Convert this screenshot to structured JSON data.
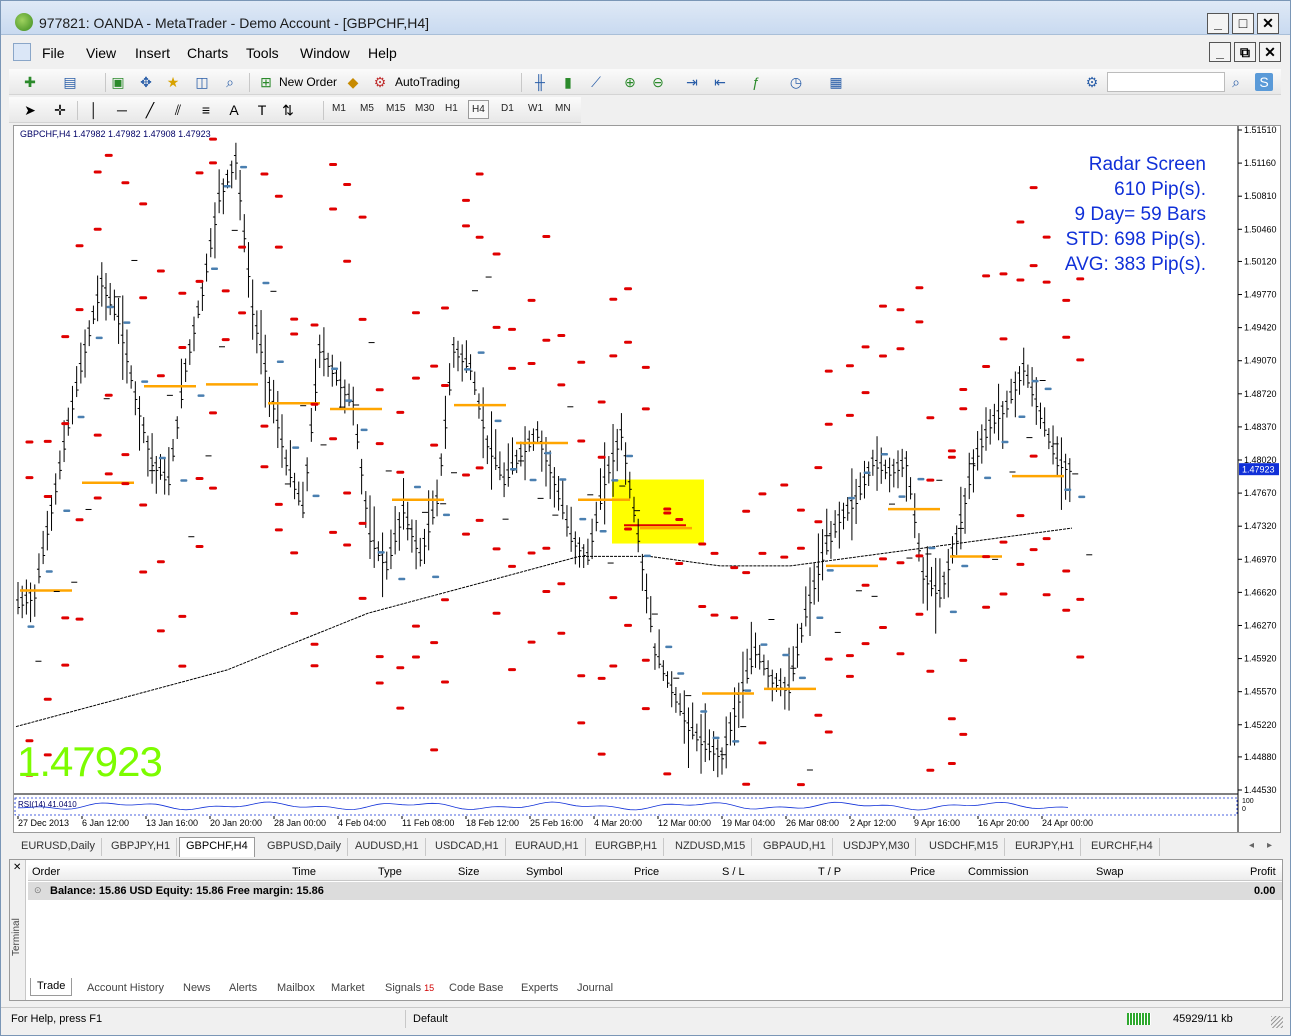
{
  "window": {
    "title": "977821: OANDA - MetaTrader - Demo Account - [GBPCHF,H4]",
    "minimize": "_",
    "maximize": "□",
    "close": "✕"
  },
  "menu": [
    "File",
    "View",
    "Insert",
    "Charts",
    "Tools",
    "Window",
    "Help"
  ],
  "toolbar": {
    "new_order": "New Order",
    "autotrading": "AutoTrading"
  },
  "timeframes": [
    "M1",
    "M5",
    "M15",
    "M30",
    "H1",
    "H4",
    "D1",
    "W1",
    "MN"
  ],
  "active_timeframe": "H4",
  "chart": {
    "header": "GBPCHF,H4  1.47982 1.47982 1.47908 1.47923",
    "big_price": "1.47923",
    "current_price_label": "1.47923",
    "radar": {
      "line1": "Radar Screen",
      "line2": "610 Pip(s).",
      "line3": "9 Day= 59 Bars",
      "line4": "STD: 698 Pip(s).",
      "line5": "AVG: 383 Pip(s)."
    },
    "rsi_label": "RSI(14) 41.0410",
    "rsi_scale_top": "100",
    "rsi_scale_bottom": "0",
    "colors": {
      "bars": "#000000",
      "red_marker": "#e00000",
      "blue_marker": "#4a7fb0",
      "orange_level": "#ffa500",
      "highlight_box": "#ffff00",
      "radar_text": "#1030d8",
      "big_price": "#7cfc00",
      "price_tag_bg": "#1030d8"
    }
  },
  "chart_data": {
    "type": "line",
    "title": "GBPCHF,H4",
    "x_ticks": [
      "27 Dec 2013",
      "6 Jan 12:00",
      "13 Jan 16:00",
      "20 Jan 20:00",
      "28 Jan 00:00",
      "4 Feb 04:00",
      "11 Feb 08:00",
      "18 Feb 12:00",
      "25 Feb 16:00",
      "4 Mar 20:00",
      "12 Mar 00:00",
      "19 Mar 04:00",
      "26 Mar 08:00",
      "2 Apr 12:00",
      "9 Apr 16:00",
      "16 Apr 20:00",
      "24 Apr 00:00"
    ],
    "y_ticks": [
      "1.51510",
      "1.51160",
      "1.50810",
      "1.50460",
      "1.50120",
      "1.49770",
      "1.49420",
      "1.49070",
      "1.48720",
      "1.48370",
      "1.48020",
      "1.47670",
      "1.47320",
      "1.46970",
      "1.46620",
      "1.46270",
      "1.45920",
      "1.45570",
      "1.45220",
      "1.44880",
      "1.44530"
    ],
    "ylim": [
      1.4453,
      1.5151
    ],
    "series": [
      {
        "name": "GBPCHF,H4",
        "values": [
          1.465,
          1.466,
          1.475,
          1.484,
          1.492,
          1.499,
          1.495,
          1.487,
          1.48,
          1.478,
          1.49,
          1.498,
          1.508,
          1.512,
          1.496,
          1.488,
          1.48,
          1.475,
          1.492,
          1.489,
          1.486,
          1.472,
          1.469,
          1.475,
          1.47,
          1.476,
          1.492,
          1.49,
          1.482,
          1.478,
          1.481,
          1.483,
          1.478,
          1.472,
          1.47,
          1.478,
          1.483,
          1.472,
          1.46,
          1.456,
          1.452,
          1.45,
          1.449,
          1.455,
          1.46,
          1.457,
          1.456,
          1.464,
          1.47,
          1.474,
          1.476,
          1.48,
          1.479,
          1.48,
          1.468,
          1.466,
          1.472,
          1.48,
          1.484,
          1.486,
          1.49,
          1.485,
          1.48,
          1.4792
        ]
      }
    ],
    "moving_average": [
      1.452,
      1.454,
      1.456,
      1.458,
      1.461,
      1.464,
      1.466,
      1.468,
      1.47,
      1.47,
      1.469,
      1.469,
      1.47,
      1.471,
      1.472,
      1.473
    ],
    "levels": [
      1.4664,
      1.4778,
      1.488,
      1.4882,
      1.4862,
      1.4856,
      1.476,
      1.486,
      1.482,
      1.476,
      1.473,
      1.4555,
      1.456,
      1.469,
      1.475,
      1.47,
      1.4785
    ],
    "highlight_box_price_range": [
      1.472,
      1.4775
    ]
  },
  "tabs": [
    "EURUSD,Daily",
    "GBPJPY,H1",
    "GBPCHF,H4",
    "GBPUSD,Daily",
    "AUDUSD,H1",
    "USDCAD,H1",
    "EURAUD,H1",
    "EURGBP,H1",
    "NZDUSD,M15",
    "GBPAUD,H1",
    "USDJPY,M30",
    "USDCHF,M15",
    "EURJPY,H1",
    "EURCHF,H4"
  ],
  "active_tab": "GBPCHF,H4",
  "terminal": {
    "side_label": "Terminal",
    "columns": [
      "Order",
      "Time",
      "Type",
      "Size",
      "Symbol",
      "Price",
      "S / L",
      "T / P",
      "Price",
      "Commission",
      "Swap",
      "Profit"
    ],
    "balance_row": "Balance: 15.86 USD  Equity: 15.86  Free margin: 15.86",
    "profit": "0.00",
    "tabs": [
      "Trade",
      "Account History",
      "News",
      "Alerts",
      "Mailbox",
      "Market",
      "Signals",
      "Code Base",
      "Experts",
      "Journal"
    ],
    "signals_badge": "15",
    "active_tab": "Trade"
  },
  "status": {
    "help": "For Help, press F1",
    "profile": "Default",
    "traffic": "45929/11 kb"
  }
}
